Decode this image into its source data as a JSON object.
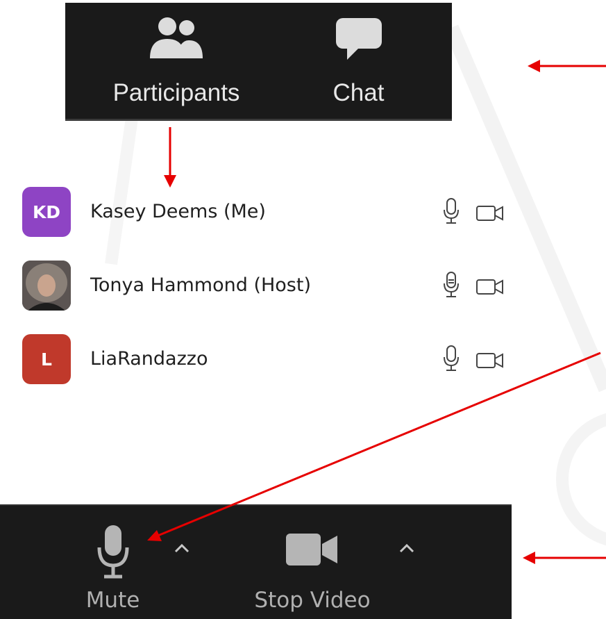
{
  "colors": {
    "toolbar_bg": "#1a1a1a",
    "toolbar_text": "#e8e8e8",
    "annotation_arrow": "#e60000",
    "avatar_kd": "#8e44c4",
    "avatar_l": "#c0392b"
  },
  "top_toolbar": {
    "participants": {
      "label": "Participants",
      "icon": "participants-icon"
    },
    "chat": {
      "label": "Chat",
      "icon": "chat-bubble-icon"
    }
  },
  "participants": [
    {
      "name": "Kasey Deems (Me)",
      "initials": "KD",
      "avatar_color": "#8e44c4",
      "mic_icon": "microphone-outline-icon",
      "video_icon": "video-camera-outline-icon"
    },
    {
      "name": "Tonya Hammond (Host)",
      "initials": "",
      "avatar_type": "photo",
      "mic_icon": "microphone-outline-icon",
      "video_icon": "video-camera-outline-icon"
    },
    {
      "name": "LiaRandazzo",
      "initials": "L",
      "avatar_color": "#c0392b",
      "mic_icon": "microphone-outline-icon",
      "video_icon": "video-camera-outline-icon"
    }
  ],
  "bottom_toolbar": {
    "mute": {
      "label": "Mute",
      "icon": "microphone-icon",
      "options_icon": "caret-up-icon"
    },
    "video": {
      "label": "Stop Video",
      "icon": "video-camera-icon",
      "options_icon": "caret-up-icon"
    }
  }
}
